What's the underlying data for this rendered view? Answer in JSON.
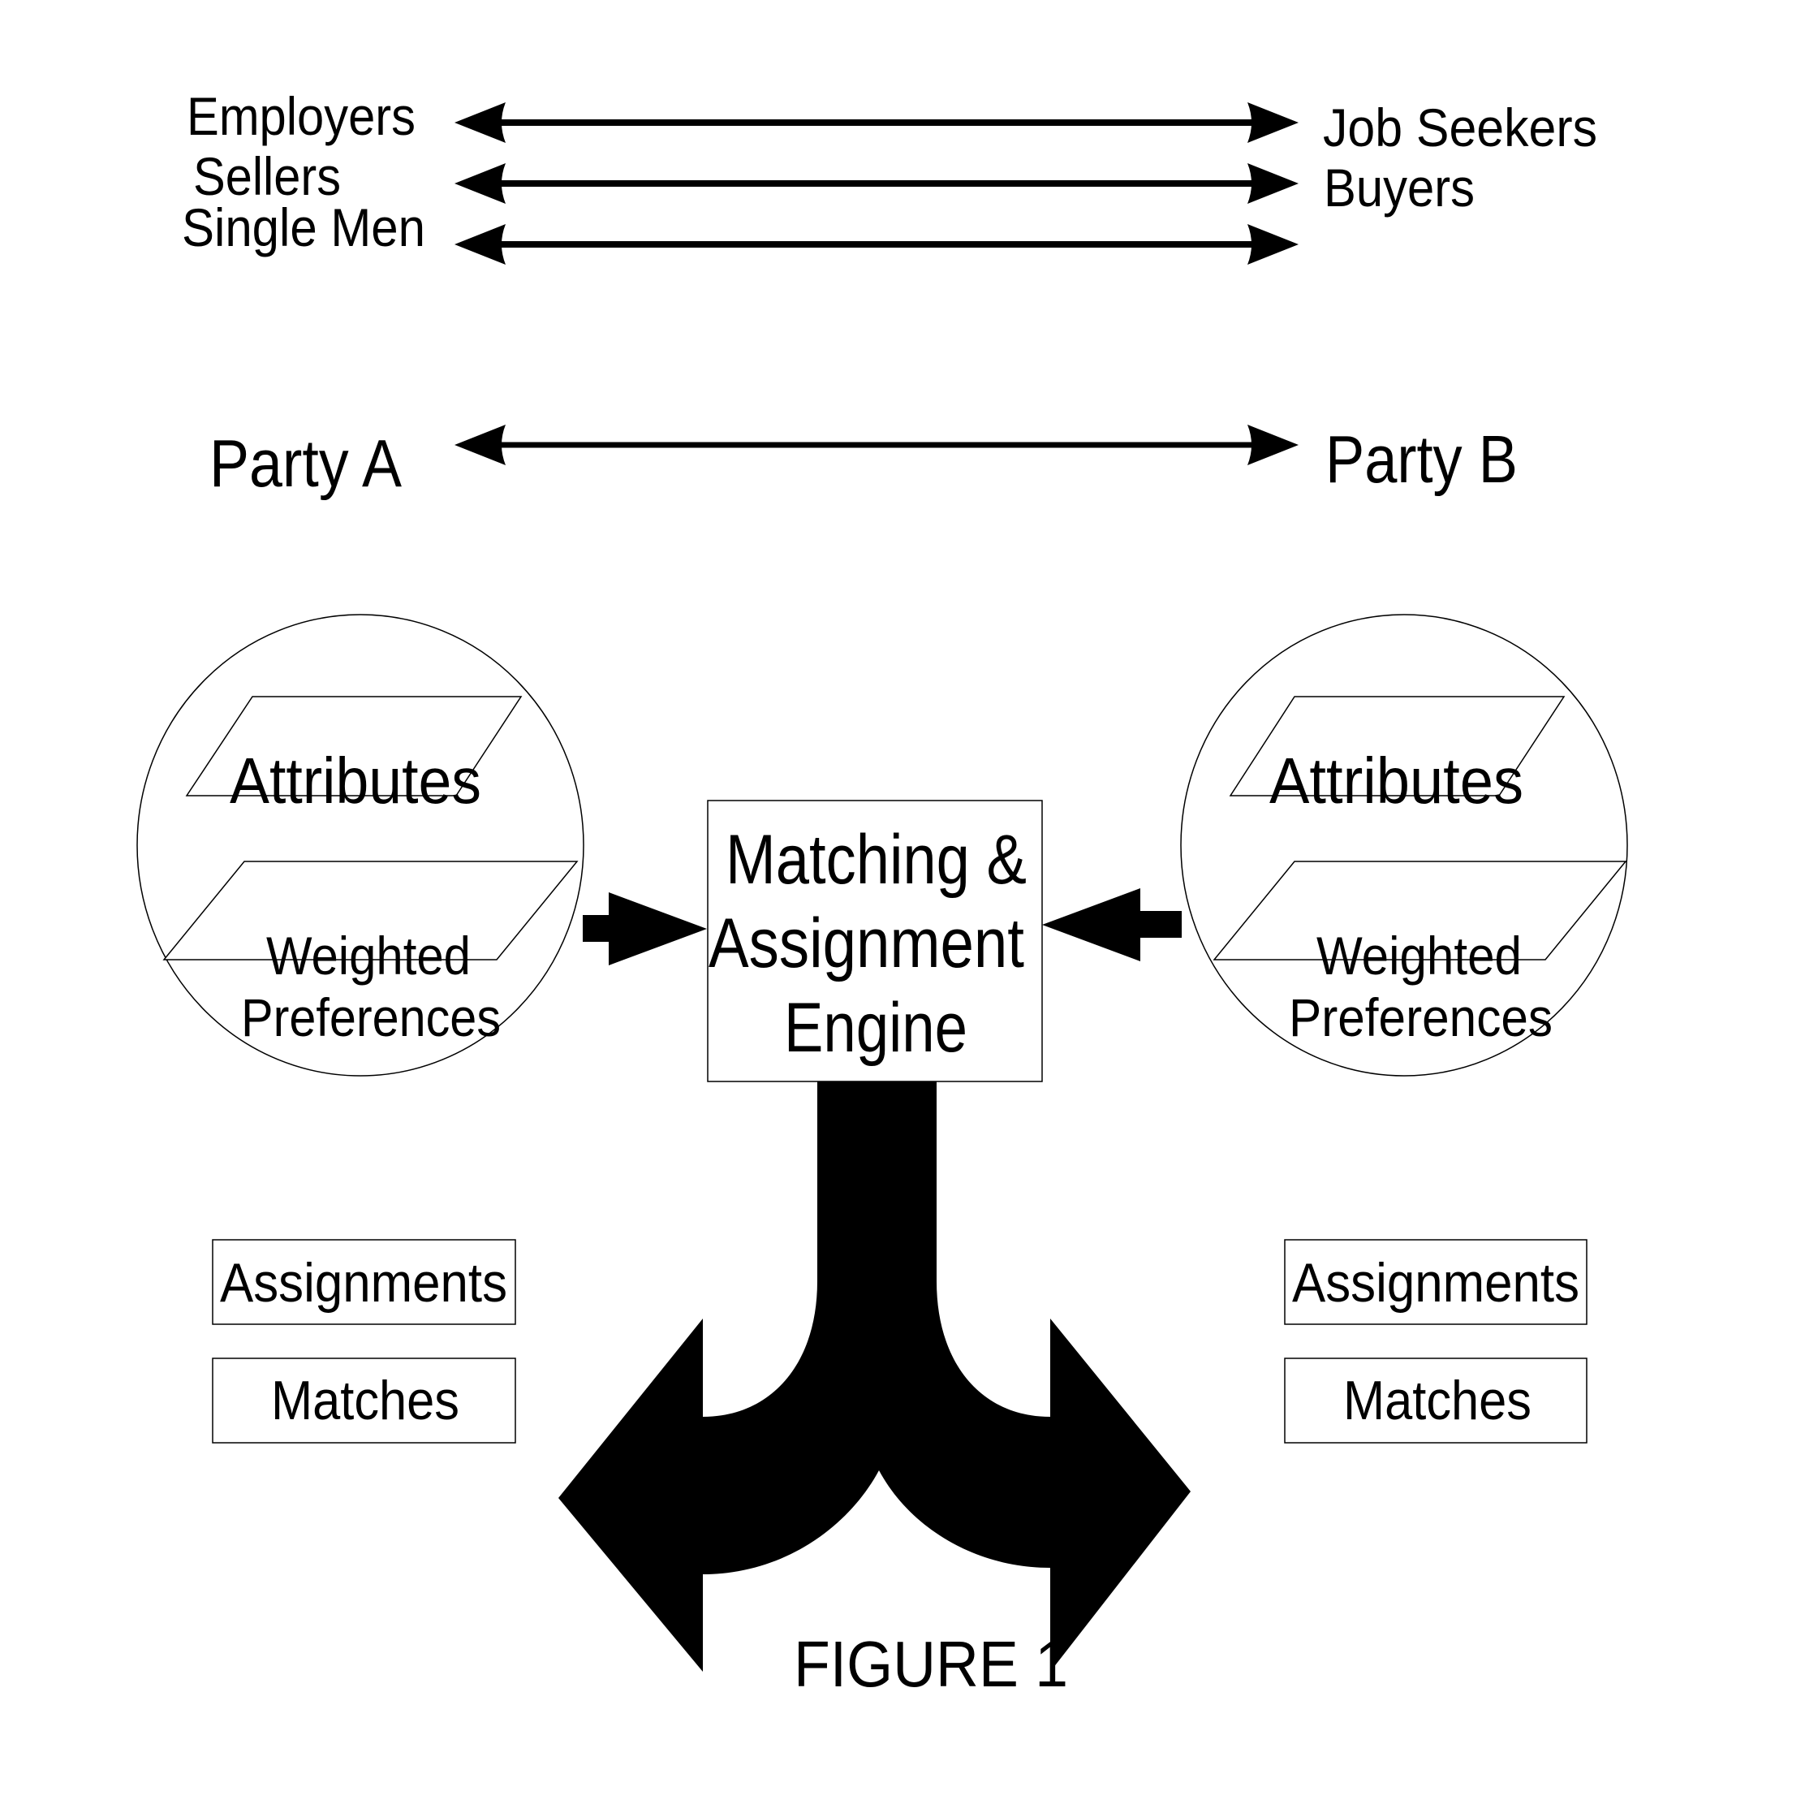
{
  "figure": {
    "caption": "FIGURE 1",
    "pairs": [
      {
        "left": "Employers",
        "right": "Job Seekers"
      },
      {
        "left": "Sellers",
        "right": "Buyers"
      },
      {
        "left": "Single Men",
        "right": ""
      }
    ],
    "parties": {
      "left": "Party A",
      "right": "Party B"
    },
    "party_a": {
      "attributes": "Attributes",
      "preferences_line1": "Weighted",
      "preferences_line2": "Preferences",
      "assignments": "Assignments",
      "matches": "Matches"
    },
    "party_b": {
      "attributes": "Attributes",
      "preferences_line1": "Weighted",
      "preferences_line2": "Preferences",
      "assignments": "Assignments",
      "matches": "Matches"
    },
    "engine": {
      "line1": "Matching &",
      "line2": "Assignment",
      "line3": "Engine"
    },
    "colors": {
      "ink": "#000000",
      "background": "#ffffff"
    }
  }
}
